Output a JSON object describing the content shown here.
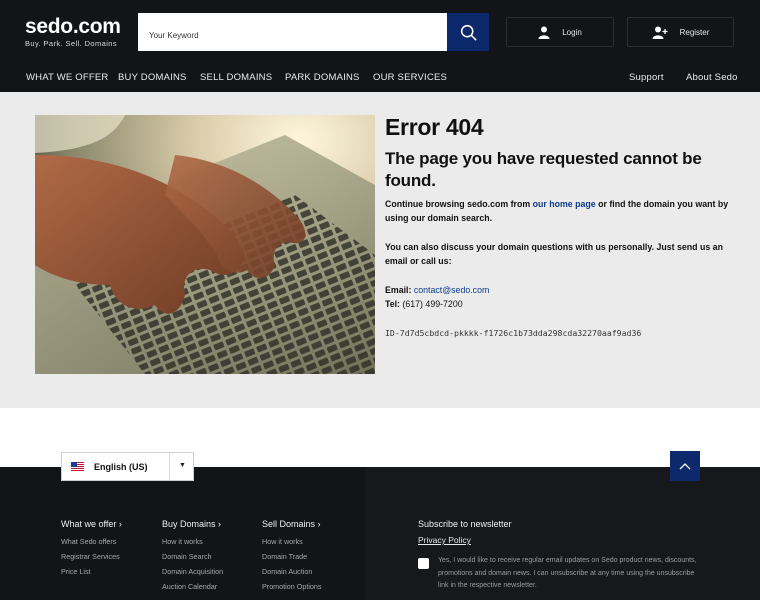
{
  "header": {
    "logo_main": "sedo.com",
    "logo_sub": "Buy. Park. Sell. Domains",
    "search_placeholder": "Your Keyword",
    "login_label": "Login",
    "register_label": "Register",
    "nav": {
      "what_we_offer": "WHAT WE OFFER",
      "buy_domains": "BUY DOMAINS",
      "sell_domains": "SELL DOMAINS",
      "park_domains": "PARK DOMAINS",
      "our_services": "OUR SERVICES",
      "support": "Support",
      "about": "About Sedo"
    }
  },
  "main": {
    "title": "Error 404",
    "subtitle": "The page you have requested cannot be found.",
    "para1_before": "Continue browsing sedo.com from ",
    "para1_link": "our home page",
    "para1_after": " or find the domain you want by using our domain search.",
    "para2": "You can also discuss your domain questions with us personally. Just send us an email or call us:",
    "email_label": "Email:",
    "email_value": "contact@sedo.com",
    "tel_label": "Tel:",
    "tel_value": "(617) 499-7200",
    "request_id": "ID-7d7d5cbdcd-pkkkk-f1726c1b73dda298cda32270aaf9ad36"
  },
  "footer": {
    "language": "English (US)",
    "columns": [
      {
        "heading": "What we offer",
        "links": [
          "What Sedo offers",
          "Registrar Services",
          "Price List"
        ]
      },
      {
        "heading": "Buy Domains",
        "links": [
          "How it works",
          "Domain Search",
          "Domain Acquisition",
          "Auction Calendar"
        ]
      },
      {
        "heading": "Sell Domains",
        "links": [
          "How it works",
          "Domain Trade",
          "Domain Auction",
          "Promotion Options"
        ]
      }
    ],
    "newsletter_title": "Subscribe to newsletter",
    "privacy_link": "Privacy Policy",
    "consent_text": "Yes, I would like to receive regular email updates on Sedo product news, discounts, promotions and domain news. I can unsubscribe at any time using the unsubscribe link in the respective newsletter."
  },
  "colors": {
    "header_bg": "#121418",
    "accent_blue": "#0c2a6b",
    "link_blue": "#0c3c8c",
    "main_bg": "#ebebeb"
  }
}
